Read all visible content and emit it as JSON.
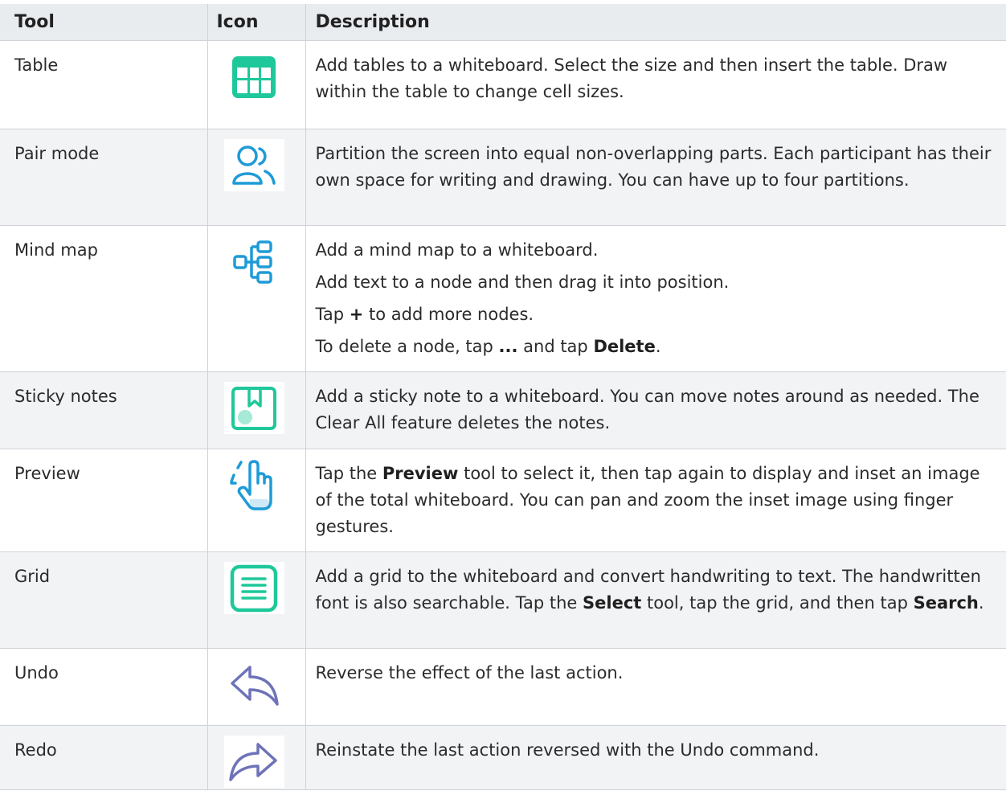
{
  "table": {
    "headers": {
      "tool": "Tool",
      "icon": "Icon",
      "description": "Description"
    },
    "rows": [
      {
        "tool": "Table",
        "icon": "table-icon",
        "description": [
          [
            {
              "t": "Add tables to a whiteboard. Select the size and then insert the table. Draw within the table to change cell sizes."
            }
          ]
        ]
      },
      {
        "tool": "Pair mode",
        "icon": "pair-mode-icon",
        "description": [
          [
            {
              "t": "Partition the screen into equal non-overlapping parts. Each participant has their own space for writing and drawing. You can have up to four partitions."
            }
          ]
        ]
      },
      {
        "tool": "Mind map",
        "icon": "mind-map-icon",
        "description": [
          [
            {
              "t": "Add a mind map to a whiteboard."
            }
          ],
          [
            {
              "t": "Add text to a node and then drag it into position."
            }
          ],
          [
            {
              "t": "Tap "
            },
            {
              "t": "+",
              "b": true
            },
            {
              "t": " to add more nodes."
            }
          ],
          [
            {
              "t": "To delete a node, tap "
            },
            {
              "t": "...",
              "b": true
            },
            {
              "t": " and tap "
            },
            {
              "t": "Delete",
              "b": true
            },
            {
              "t": "."
            }
          ]
        ]
      },
      {
        "tool": "Sticky notes",
        "icon": "sticky-notes-icon",
        "description": [
          [
            {
              "t": "Add a sticky note to a whiteboard. You can move notes around as needed. The Clear All feature deletes the notes."
            }
          ]
        ]
      },
      {
        "tool": "Preview",
        "icon": "preview-hand-icon",
        "description": [
          [
            {
              "t": "Tap the "
            },
            {
              "t": "Preview",
              "b": true
            },
            {
              "t": " tool to select it, then tap again to display and inset an image of the total whiteboard. You can pan and zoom the inset image using finger gestures."
            }
          ]
        ]
      },
      {
        "tool": "Grid",
        "icon": "grid-icon",
        "description": [
          [
            {
              "t": "Add a grid to the whiteboard and convert handwriting to text. The handwritten font is also searchable. Tap the "
            },
            {
              "t": "Select",
              "b": true
            },
            {
              "t": " tool, tap the grid, and then tap "
            },
            {
              "t": "Search",
              "b": true
            },
            {
              "t": "."
            }
          ]
        ]
      },
      {
        "tool": "Undo",
        "icon": "undo-icon",
        "description": [
          [
            {
              "t": "Reverse the effect of the last action."
            }
          ]
        ]
      },
      {
        "tool": "Redo",
        "icon": "redo-icon",
        "description": [
          [
            {
              "t": "Reinstate the last action reversed with the Undo command."
            }
          ]
        ]
      }
    ]
  },
  "colors": {
    "header_bg": "#e9ecef",
    "alt_row_bg": "#f2f3f5",
    "green_icon": "#1fc89a",
    "blue_icon": "#1e9bd7",
    "arrow_icon": "#6e73b8"
  }
}
